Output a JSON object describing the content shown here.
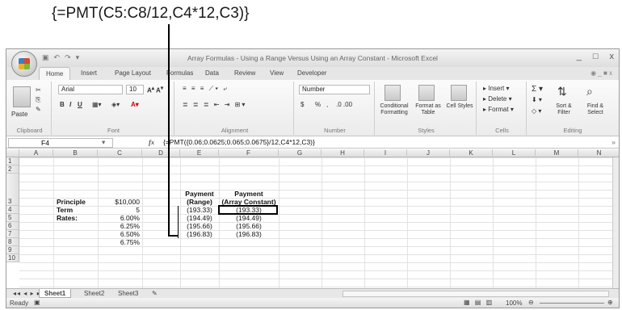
{
  "callout": "{=PMT(C5:C8/12,C4*12,C3)}",
  "window": {
    "title": "Array Formulas - Using a Range Versus Using an Array Constant - Microsoft Excel",
    "controls": [
      "_",
      "□",
      "x"
    ]
  },
  "tabs": [
    "Home",
    "Insert",
    "Page Layout",
    "Formulas",
    "Data",
    "Review",
    "View",
    "Developer"
  ],
  "ribbon": {
    "clipboard": {
      "paste": "Paste",
      "label": "Clipboard"
    },
    "font": {
      "name": "Arial",
      "size": "10",
      "label": "Font"
    },
    "alignment": {
      "label": "Alignment"
    },
    "number": {
      "format": "Number",
      "currency": "$",
      "percent": "%",
      "comma": ",",
      "label": "Number"
    },
    "styles": {
      "conditional": "Conditional Formatting",
      "format_table": "Format as Table",
      "cell_styles": "Cell Styles",
      "label": "Styles"
    },
    "cells": {
      "insert": "Insert",
      "delete": "Delete",
      "format": "Format",
      "label": "Cells"
    },
    "editing": {
      "sort": "Sort & Filter",
      "find": "Find & Select",
      "label": "Editing"
    }
  },
  "formula_bar": {
    "name_box": "F4",
    "fx": "fx",
    "formula": "{=PMT({0.06;0.0625;0.065;0.0675}/12,C4*12,C3)}"
  },
  "columns": [
    "A",
    "B",
    "C",
    "D",
    "E",
    "F",
    "G",
    "H",
    "I",
    "J",
    "K",
    "L",
    "M",
    "N"
  ],
  "rows": [
    "1",
    "2",
    "3",
    "4",
    "5",
    "6",
    "7",
    "8",
    "9",
    "10"
  ],
  "cells": {
    "b3": "Principle",
    "c3": "$10,000",
    "b4": "Term",
    "c4": "5",
    "b5": "Rates:",
    "c5": "6.00%",
    "c6": "6.25%",
    "c7": "6.50%",
    "c8": "6.75%",
    "e_header1": "Payment",
    "e_header2": "(Range)",
    "f_header1": "Payment",
    "f_header2": "(Array Constant)",
    "e4": "(193.33)",
    "e5": "(194.49)",
    "e6": "(195.66)",
    "e7": "(196.83)",
    "f4": "(193.33)",
    "f5": "(194.49)",
    "f6": "(195.66)",
    "f7": "(196.83)"
  },
  "sheets": [
    "Sheet1",
    "Sheet2",
    "Sheet3"
  ],
  "status": {
    "ready": "Ready",
    "zoom": "100%"
  }
}
